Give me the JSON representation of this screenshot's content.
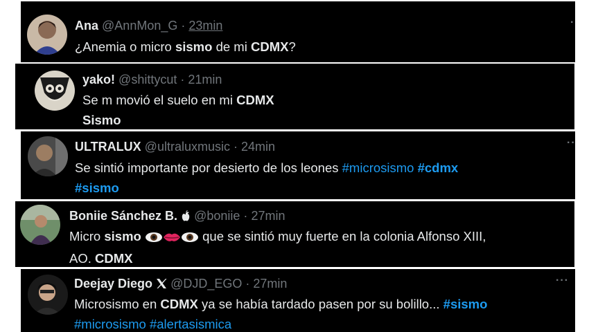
{
  "tweets": [
    {
      "name": "Ana",
      "handle": "@AnnMon_G",
      "sep": "·",
      "time": "23min",
      "body": {
        "t1": "¿Anemia o micro ",
        "b1": "sismo",
        "t2": " de mi ",
        "b2": "CDMX",
        "t3": "?"
      }
    },
    {
      "name": "yako!",
      "handle": "@shittycut",
      "sep": "·",
      "time": "21min",
      "body": {
        "t1": "Se m movió el suelo en mi ",
        "b1": "CDMX",
        "line2": "Sismo"
      }
    },
    {
      "name": "ULTRALUX",
      "handle": "@ultraluxmusic",
      "sep": "·",
      "time": "24min",
      "body": {
        "t1": "Se sintió importante por desierto de los leones ",
        "tag1": "#microsismo",
        "tag2": "#cdmx",
        "tag3": "#sismo"
      }
    },
    {
      "name": "Boniie Sánchez B.",
      "name_icon": "apple-icon",
      "handle": "@boniie",
      "sep": "·",
      "time": "27min",
      "body": {
        "t1": "Micro ",
        "b1": "sismo",
        "t2": " que se sintió muy fuerte en la colonia Alfonso XIII,",
        "t3": "AO. ",
        "b2": "CDMX"
      },
      "emojis": [
        "eye-icon",
        "lips-icon",
        "eye-icon"
      ]
    },
    {
      "name": "Deejay Diego",
      "name_icon": "x-logo-icon",
      "handle": "@DJD_EGO",
      "sep": "·",
      "time": "27min",
      "body": {
        "t1": "Microsismo en  ",
        "b1": "CDMX",
        "t2": " ya se había tardado pasen por su bolillo... ",
        "tag1": "#sismo",
        "tag2": "#microsismo",
        "tag3": "#alertasismica"
      }
    }
  ],
  "more_icon": "ellipsis-icon",
  "colors": {
    "background": "#000000",
    "text": "#e7e9ea",
    "muted": "#71767b",
    "link": "#1d9bf0"
  }
}
